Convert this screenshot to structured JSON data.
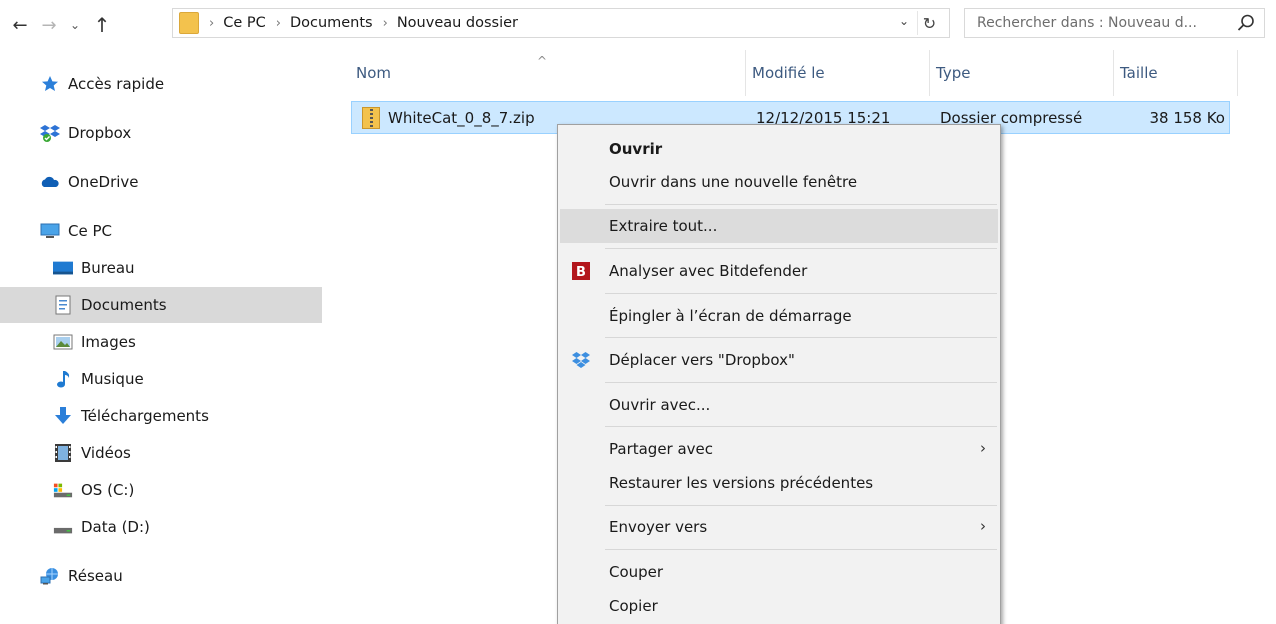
{
  "address_bar": {
    "breadcrumbs": [
      "Ce PC",
      "Documents",
      "Nouveau dossier"
    ],
    "search_placeholder": "Rechercher dans : Nouveau d..."
  },
  "sidebar": {
    "items": [
      {
        "label": "Accès rapide",
        "icon": "star-icon"
      },
      {
        "label": "Dropbox",
        "icon": "dropbox-icon"
      },
      {
        "label": "OneDrive",
        "icon": "cloud-icon"
      },
      {
        "label": "Ce PC",
        "icon": "computer-icon"
      },
      {
        "label": "Bureau",
        "icon": "desktop-icon"
      },
      {
        "label": "Documents",
        "icon": "documents-icon"
      },
      {
        "label": "Images",
        "icon": "images-icon"
      },
      {
        "label": "Musique",
        "icon": "music-icon"
      },
      {
        "label": "Téléchargements",
        "icon": "download-icon"
      },
      {
        "label": "Vidéos",
        "icon": "video-icon"
      },
      {
        "label": "OS (C:)",
        "icon": "drive-c-icon"
      },
      {
        "label": "Data (D:)",
        "icon": "drive-d-icon"
      },
      {
        "label": "Réseau",
        "icon": "network-icon"
      }
    ]
  },
  "columns": {
    "name": "Nom",
    "modified": "Modifié le",
    "type": "Type",
    "size": "Taille"
  },
  "file": {
    "name": "WhiteCat_0_8_7.zip",
    "modified": "12/12/2015 15:21",
    "type": "Dossier compressé",
    "size": "38 158 Ko"
  },
  "context_menu": {
    "items": [
      {
        "label": "Ouvrir"
      },
      {
        "label": "Ouvrir dans une nouvelle fenêtre"
      },
      {
        "label": "Extraire tout..."
      },
      {
        "label": "Analyser avec Bitdefender",
        "icon": "bitdefender-icon"
      },
      {
        "label": "Épingler à l’écran de démarrage"
      },
      {
        "label": "Déplacer vers \"Dropbox\"",
        "icon": "dropbox-icon"
      },
      {
        "label": "Ouvrir avec..."
      },
      {
        "label": "Partager avec"
      },
      {
        "label": "Restaurer les versions précédentes"
      },
      {
        "label": "Envoyer vers"
      },
      {
        "label": "Couper"
      },
      {
        "label": "Copier"
      }
    ]
  },
  "colors": {
    "selection_bg": "#cce8ff",
    "selection_border": "#99d1ff",
    "sidebar_selected": "#d9d9d9",
    "menu_bg": "#f2f2f2",
    "menu_hover": "#dcdcdc",
    "header_text": "#3d5a80"
  }
}
